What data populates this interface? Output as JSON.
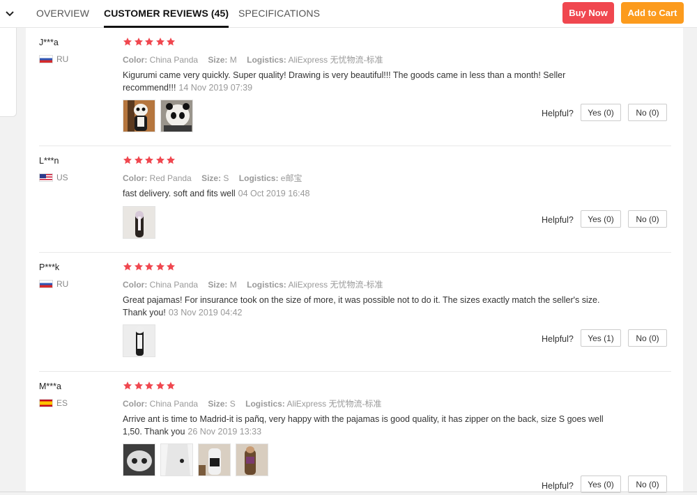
{
  "nav": {
    "tabs": [
      {
        "label": "OVERVIEW"
      },
      {
        "label": "CUSTOMER REVIEWS (45)"
      },
      {
        "label": "SPECIFICATIONS"
      }
    ],
    "buy_now": "Buy Now",
    "add_to_cart": "Add to Cart"
  },
  "labels": {
    "color": "Color:",
    "size": "Size:",
    "logistics": "Logistics:",
    "helpful": "Helpful?"
  },
  "colors": {
    "buy_now": "#f0474f",
    "add_to_cart": "#fc9b1d",
    "star": "#f0474f"
  },
  "reviews": [
    {
      "user": "J***a",
      "country": "RU",
      "rating": 5,
      "color": "China Panda",
      "size": "M",
      "logistics": "AliExpress 无忧物流-标准",
      "text": "Kigurumi came very quickly. Super quality! Drawing is very beautiful!!! The goods came in less than a month! Seller recommend!!!",
      "date": "14 Nov 2019 07:39",
      "yes": "Yes (0)",
      "no": "No (0)"
    },
    {
      "user": "L***n",
      "country": "US",
      "rating": 5,
      "color": "Red Panda",
      "size": "S",
      "logistics": "e邮宝",
      "text": "fast delivery. soft and fits well",
      "date": "04 Oct 2019 16:48",
      "yes": "Yes (0)",
      "no": "No (0)"
    },
    {
      "user": "P***k",
      "country": "RU",
      "rating": 5,
      "color": "China Panda",
      "size": "M",
      "logistics": "AliExpress 无忧物流-标准",
      "text": "Great pajamas! For insurance took on the size of more, it was possible not to do it. The sizes exactly match the seller's size. Thank you!",
      "date": "03 Nov 2019 04:42",
      "yes": "Yes (1)",
      "no": "No (0)"
    },
    {
      "user": "M***a",
      "country": "ES",
      "rating": 5,
      "color": "China Panda",
      "size": "S",
      "logistics": "AliExpress 无忧物流-标准",
      "text": "Arrive ant is time to Madrid-it is pañq, very happy with the pajamas is good quality, it has zipper on the back, size S goes well 1,50. Thank you",
      "date": "26 Nov 2019 13:33",
      "yes": "Yes (0)",
      "no": "No (0)"
    }
  ]
}
